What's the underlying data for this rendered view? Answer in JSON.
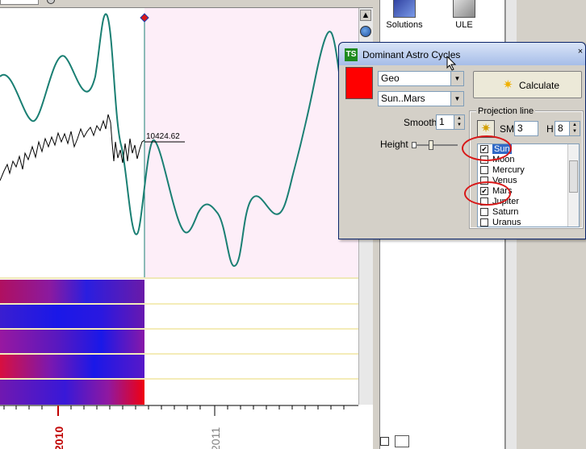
{
  "chart": {
    "price_label": "10424.62",
    "year_2010": "2010",
    "year_2011": "2011",
    "colors": {
      "projection_bg": "#fdeef8",
      "cycle_line": "#1a7f73",
      "price_line": "#000000",
      "heat_low": "#1818e6",
      "heat_high": "#ee0000",
      "year_label": "#c00000"
    },
    "heatmap_rows": 5
  },
  "toolbar": {
    "solutions_label": "Solutions",
    "ule_label": "ULE"
  },
  "dialog": {
    "title": "Dominant Astro Cycles",
    "close_glyph": "×",
    "logo_text": "TS",
    "coord_combo": "Geo",
    "planets_combo": "Sun..Mars",
    "calculate_label": "Calculate",
    "smooth_label": "Smooth",
    "smooth_value": "1",
    "height_label": "Height",
    "projection_line_label": "Projection line",
    "sm_label": "SM",
    "sm_value": "3",
    "h_label": "H",
    "h_value": "8",
    "swatch_color": "#ff0000",
    "planets": [
      {
        "label": "Sun",
        "checked": true,
        "selected": true
      },
      {
        "label": "Moon",
        "checked": false,
        "selected": false
      },
      {
        "label": "Mercury",
        "checked": false,
        "selected": false
      },
      {
        "label": "Venus",
        "checked": false,
        "selected": false
      },
      {
        "label": "Mars",
        "checked": true,
        "selected": false
      },
      {
        "label": "Jupiter",
        "checked": false,
        "selected": false
      },
      {
        "label": "Saturn",
        "checked": false,
        "selected": false
      },
      {
        "label": "Uranus",
        "checked": false,
        "selected": false
      }
    ]
  }
}
